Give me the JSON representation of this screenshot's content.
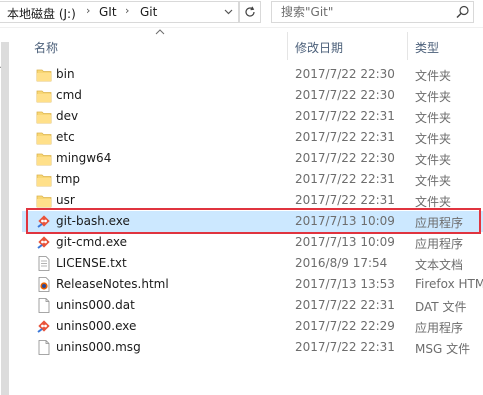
{
  "address": {
    "crumbs": [
      "本地磁盘 (J:)",
      "GIt",
      "Git"
    ],
    "separator": "›",
    "dropdown_icon": "chevron-down-icon",
    "refresh_icon": "refresh-icon"
  },
  "search": {
    "placeholder": "搜索\"Git\"",
    "icon": "search-icon"
  },
  "columns": {
    "name": "名称",
    "date": "修改日期",
    "type": "类型"
  },
  "files": [
    {
      "name": "bin",
      "date": "2017/7/22 22:30",
      "type": "文件夹",
      "icon": "folder-icon"
    },
    {
      "name": "cmd",
      "date": "2017/7/22 22:30",
      "type": "文件夹",
      "icon": "folder-icon"
    },
    {
      "name": "dev",
      "date": "2017/7/22 22:31",
      "type": "文件夹",
      "icon": "folder-icon"
    },
    {
      "name": "etc",
      "date": "2017/7/22 22:31",
      "type": "文件夹",
      "icon": "folder-icon"
    },
    {
      "name": "mingw64",
      "date": "2017/7/22 22:30",
      "type": "文件夹",
      "icon": "folder-icon"
    },
    {
      "name": "tmp",
      "date": "2017/7/22 22:31",
      "type": "文件夹",
      "icon": "folder-icon"
    },
    {
      "name": "usr",
      "date": "2017/7/22 22:31",
      "type": "文件夹",
      "icon": "folder-icon"
    },
    {
      "name": "git-bash.exe",
      "date": "2017/7/13 10:09",
      "type": "应用程序",
      "icon": "git-app-icon",
      "selected": true
    },
    {
      "name": "git-cmd.exe",
      "date": "2017/7/13 10:09",
      "type": "应用程序",
      "icon": "git-app-icon"
    },
    {
      "name": "LICENSE.txt",
      "date": "2016/8/9 17:54",
      "type": "文本文档",
      "icon": "text-document-icon"
    },
    {
      "name": "ReleaseNotes.html",
      "date": "2017/7/13 13:53",
      "type": "Firefox HTM",
      "icon": "firefox-html-icon"
    },
    {
      "name": "unins000.dat",
      "date": "2017/7/22 22:31",
      "type": "DAT 文件",
      "icon": "generic-file-icon"
    },
    {
      "name": "unins000.exe",
      "date": "2017/7/22 22:29",
      "type": "应用程序",
      "icon": "git-app-icon"
    },
    {
      "name": "unins000.msg",
      "date": "2017/7/22 22:31",
      "type": "MSG 文件",
      "icon": "generic-file-icon"
    }
  ],
  "colors": {
    "selection": "#cce8ff",
    "highlight_border": "#e0343f",
    "folder": "#f8d775",
    "git_orange": "#e9533a"
  }
}
